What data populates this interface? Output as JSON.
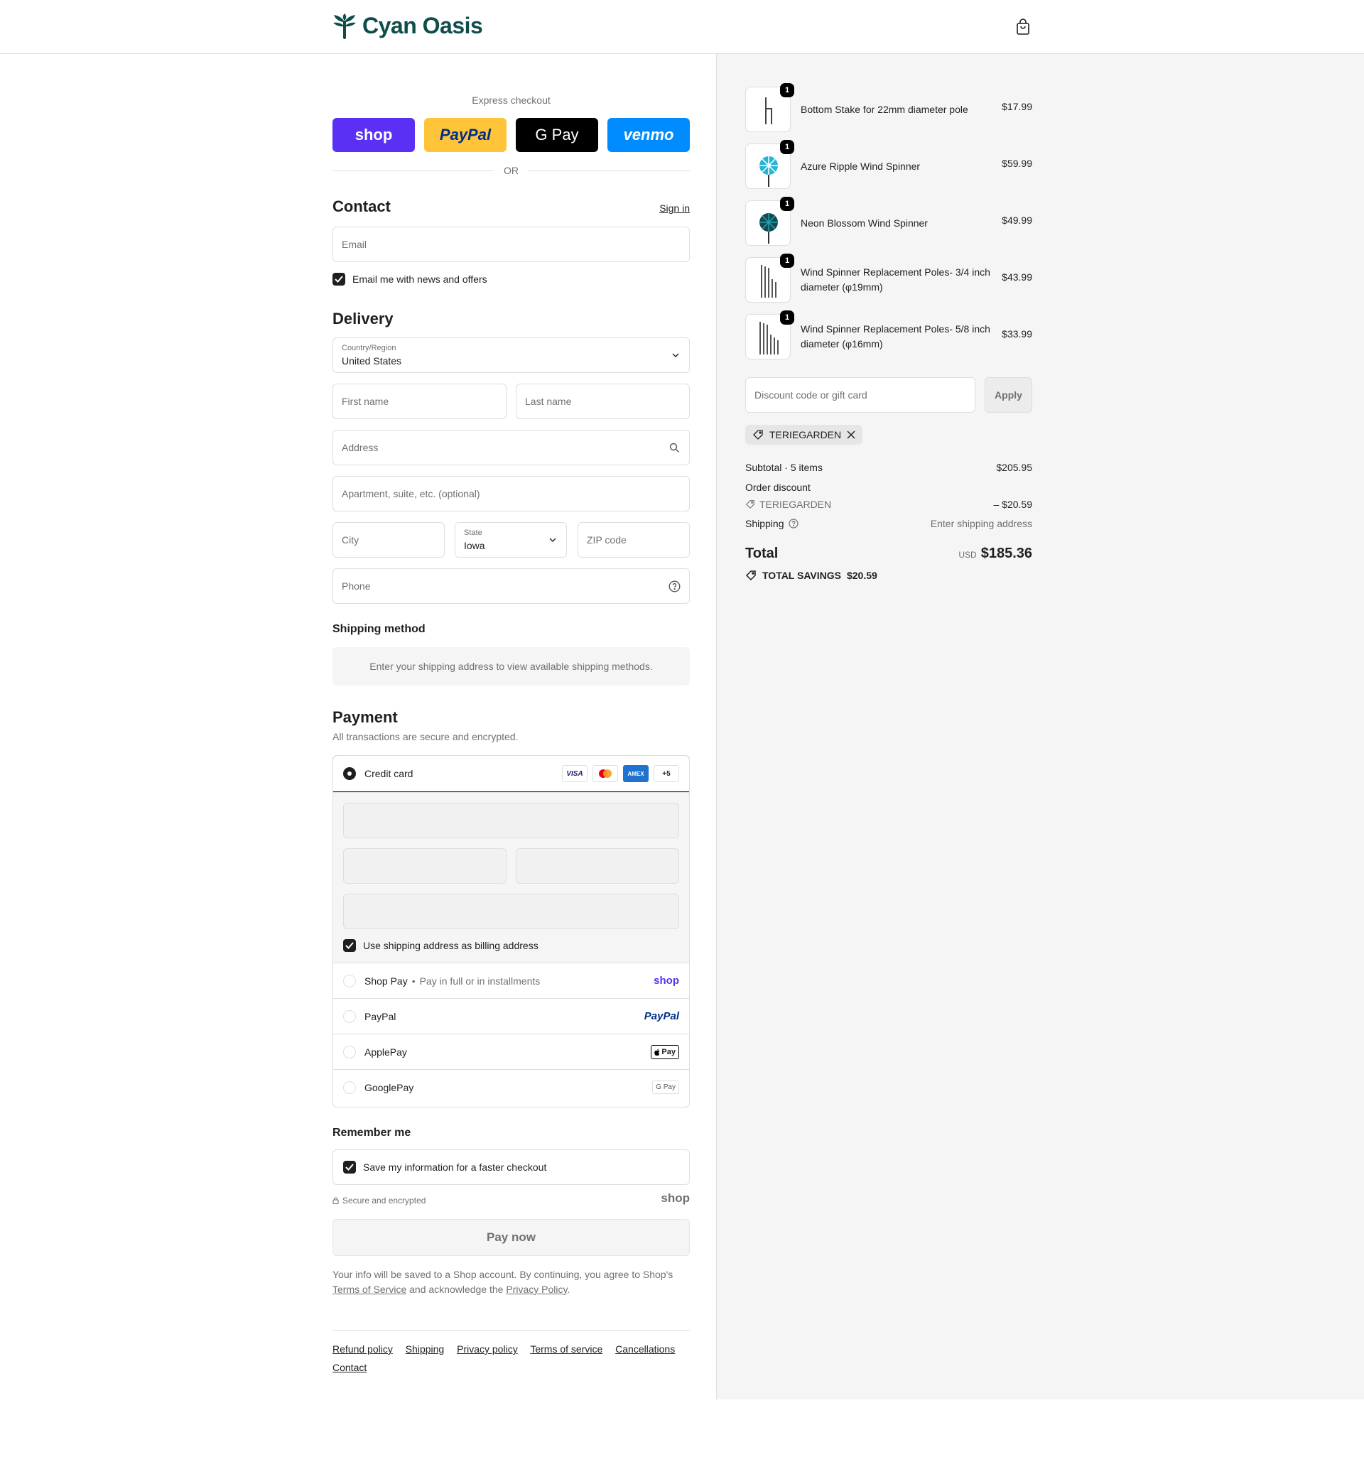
{
  "brand": {
    "name": "Cyan Oasis",
    "accent": "#0e4d4a"
  },
  "express": {
    "title": "Express checkout",
    "buttons": [
      {
        "label": "shop",
        "bg": "#5a31f4",
        "fg": "#ffffff"
      },
      {
        "label": "PayPal",
        "bg": "#ffc439",
        "fg": "#003087"
      },
      {
        "label": "G Pay",
        "bg": "#000000",
        "fg": "#ffffff"
      },
      {
        "label": "venmo",
        "bg": "#008cff",
        "fg": "#ffffff"
      }
    ],
    "or": "OR"
  },
  "contact": {
    "title": "Contact",
    "sign_in": "Sign in",
    "email_placeholder": "Email",
    "news_label": "Email me with news and offers"
  },
  "delivery": {
    "title": "Delivery",
    "country_label": "Country/Region",
    "country_value": "United States",
    "first_name": "First name",
    "last_name": "Last name",
    "address": "Address",
    "apartment": "Apartment, suite, etc. (optional)",
    "city": "City",
    "state_label": "State",
    "state_value": "Iowa",
    "zip": "ZIP code",
    "phone": "Phone"
  },
  "shipping_method": {
    "title": "Shipping method",
    "message": "Enter your shipping address to view available shipping methods."
  },
  "payment": {
    "title": "Payment",
    "subtitle": "All transactions are secure and encrypted.",
    "credit_card": "Credit card",
    "card_logos": [
      "VISA",
      "MC",
      "AMEX",
      "+5"
    ],
    "billing_label": "Use shipping address as billing address",
    "shop_pay": "Shop Pay",
    "shop_pay_note": "Pay in full or in installments",
    "shop_pay_logo": "shop",
    "paypal": "PayPal",
    "paypal_logo": "PayPal",
    "applepay": "ApplePay",
    "applepay_logo": "Pay",
    "googlepay": "GooglePay",
    "googlepay_logo": "G Pay"
  },
  "remember": {
    "title": "Remember me",
    "save_label": "Save my information for a faster checkout",
    "secure": "Secure and encrypted",
    "shop_logo": "shop"
  },
  "pay_now": "Pay now",
  "legal": {
    "text1": "Your info will be saved to a Shop account. By continuing, you agree to Shop's",
    "tos": "Terms of Service",
    "text2": "and acknowledge the",
    "privacy": "Privacy Policy",
    "period": "."
  },
  "footer": {
    "links": [
      "Refund policy",
      "Shipping",
      "Privacy policy",
      "Terms of service",
      "Cancellations",
      "Contact"
    ]
  },
  "order": {
    "items": [
      {
        "name": "Bottom Stake for 22mm diameter pole",
        "price": "$17.99",
        "qty": "1"
      },
      {
        "name": "Azure Ripple Wind Spinner",
        "price": "$59.99",
        "qty": "1"
      },
      {
        "name": "Neon Blossom Wind Spinner",
        "price": "$49.99",
        "qty": "1"
      },
      {
        "name": "Wind Spinner Replacement Poles- 3/4 inch diameter (φ19mm)",
        "price": "$43.99",
        "qty": "1"
      },
      {
        "name": "Wind Spinner Replacement Poles- 5/8 inch diameter (φ16mm)",
        "price": "$33.99",
        "qty": "1"
      }
    ],
    "discount_placeholder": "Discount code or gift card",
    "apply": "Apply",
    "code": "TERIEGARDEN",
    "subtotal_label": "Subtotal · 5 items",
    "subtotal": "$205.95",
    "order_discount": "Order discount",
    "discount_code": "TERIEGARDEN",
    "discount_amount": "– $20.59",
    "shipping_label": "Shipping",
    "shipping_value": "Enter shipping address",
    "total_label": "Total",
    "currency": "USD",
    "total": "$185.36",
    "savings_label": "TOTAL SAVINGS",
    "savings": "$20.59"
  }
}
